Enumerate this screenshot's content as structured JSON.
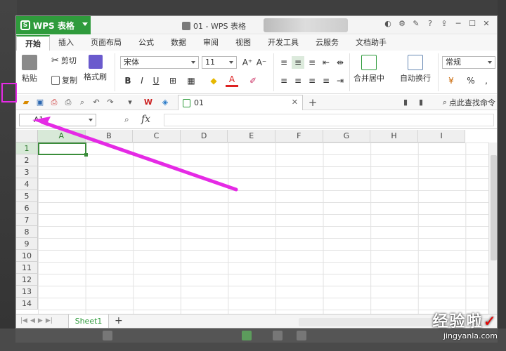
{
  "app": {
    "menu_label": "WPS 表格",
    "logo_letter": "S",
    "doc_title": "01 - WPS 表格"
  },
  "tabs": [
    "开始",
    "插入",
    "页面布局",
    "公式",
    "数据",
    "审阅",
    "视图",
    "开发工具",
    "云服务",
    "文档助手"
  ],
  "ribbon": {
    "paste": "粘贴",
    "cut": "剪切",
    "copy": "复制",
    "format_painter": "格式刷",
    "font_name": "宋体",
    "font_size": "11",
    "bold": "B",
    "italic": "I",
    "underline": "U",
    "font_color_letter": "A",
    "grow_font": "A⁺",
    "shrink_font": "A⁻",
    "merge_center": "合并居中",
    "wrap_text": "自动换行",
    "number_format": "常规",
    "percent": "%"
  },
  "quick_bar": {
    "doc_tab_label": "01",
    "search_command": "点此查找命令"
  },
  "formula_bar": {
    "name_box": "A1",
    "fx_label": "fx"
  },
  "grid": {
    "columns": [
      "A",
      "B",
      "C",
      "D",
      "E",
      "F",
      "G",
      "H",
      "I"
    ],
    "rows": [
      "1",
      "2",
      "3",
      "4",
      "5",
      "6",
      "7",
      "8",
      "9",
      "10",
      "11",
      "12",
      "13",
      "14"
    ],
    "active_cell": "A1"
  },
  "sheets": {
    "tabs": [
      "Sheet1"
    ],
    "add_label": "+"
  },
  "watermark": {
    "main": "经验啦",
    "check": "✓",
    "sub": "jingyanla.com"
  },
  "colors": {
    "brand_green": "#2f9b3c",
    "highlight_magenta": "#e52ae5"
  }
}
